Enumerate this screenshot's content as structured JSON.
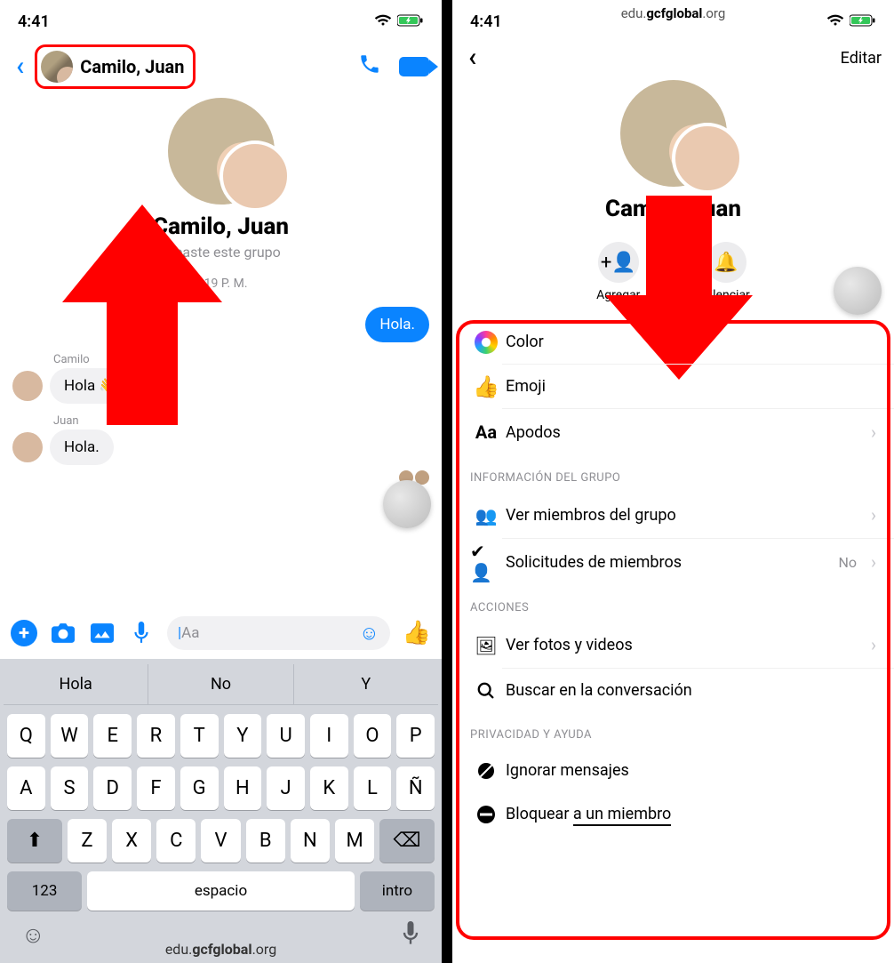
{
  "status": {
    "time": "4:41"
  },
  "watermark": {
    "prefix": "edu.",
    "bold": "gcfglobal",
    "suffix": ".org"
  },
  "left": {
    "title": "Camilo, Juan",
    "group_name": "Camilo, Juan",
    "group_sub": "Creaste este grupo",
    "group_time": "3:19 P. M.",
    "msg_out": "Hola.",
    "senders": {
      "s1": "Camilo",
      "s2": "Juan"
    },
    "msg_in1": "Hola 👋",
    "msg_in2": "Hola.",
    "composer_placeholder": "Aa",
    "sugg": {
      "a": "Hola",
      "b": "No",
      "c": "Y"
    },
    "keys": {
      "r1": [
        "Q",
        "W",
        "E",
        "R",
        "T",
        "Y",
        "U",
        "I",
        "O",
        "P"
      ],
      "r2": [
        "A",
        "S",
        "D",
        "F",
        "G",
        "H",
        "J",
        "K",
        "L",
        "Ñ"
      ],
      "r3": [
        "Z",
        "X",
        "C",
        "V",
        "B",
        "N",
        "M"
      ],
      "n123": "123",
      "space": "espacio",
      "intro": "intro"
    }
  },
  "right": {
    "edit": "Editar",
    "group_name": "Camilo, Juan",
    "actions": {
      "add": "Agregar",
      "mute": "Silenciar"
    },
    "rows": {
      "color": "Color",
      "emoji": "Emoji",
      "apodos": "Apodos"
    },
    "section_info": "INFORMACIÓN DEL GRUPO",
    "info": {
      "members": "Ver miembros del grupo",
      "requests": "Solicitudes de miembros",
      "requests_val": "No"
    },
    "section_actions": "ACCIONES",
    "act": {
      "media": "Ver fotos y videos",
      "search": "Buscar en la conversación"
    },
    "section_privacy": "PRIVACIDAD Y AYUDA",
    "priv": {
      "ignore": "Ignorar mensajes",
      "block_a": "Bloquear ",
      "block_b": "a un miembro"
    }
  }
}
